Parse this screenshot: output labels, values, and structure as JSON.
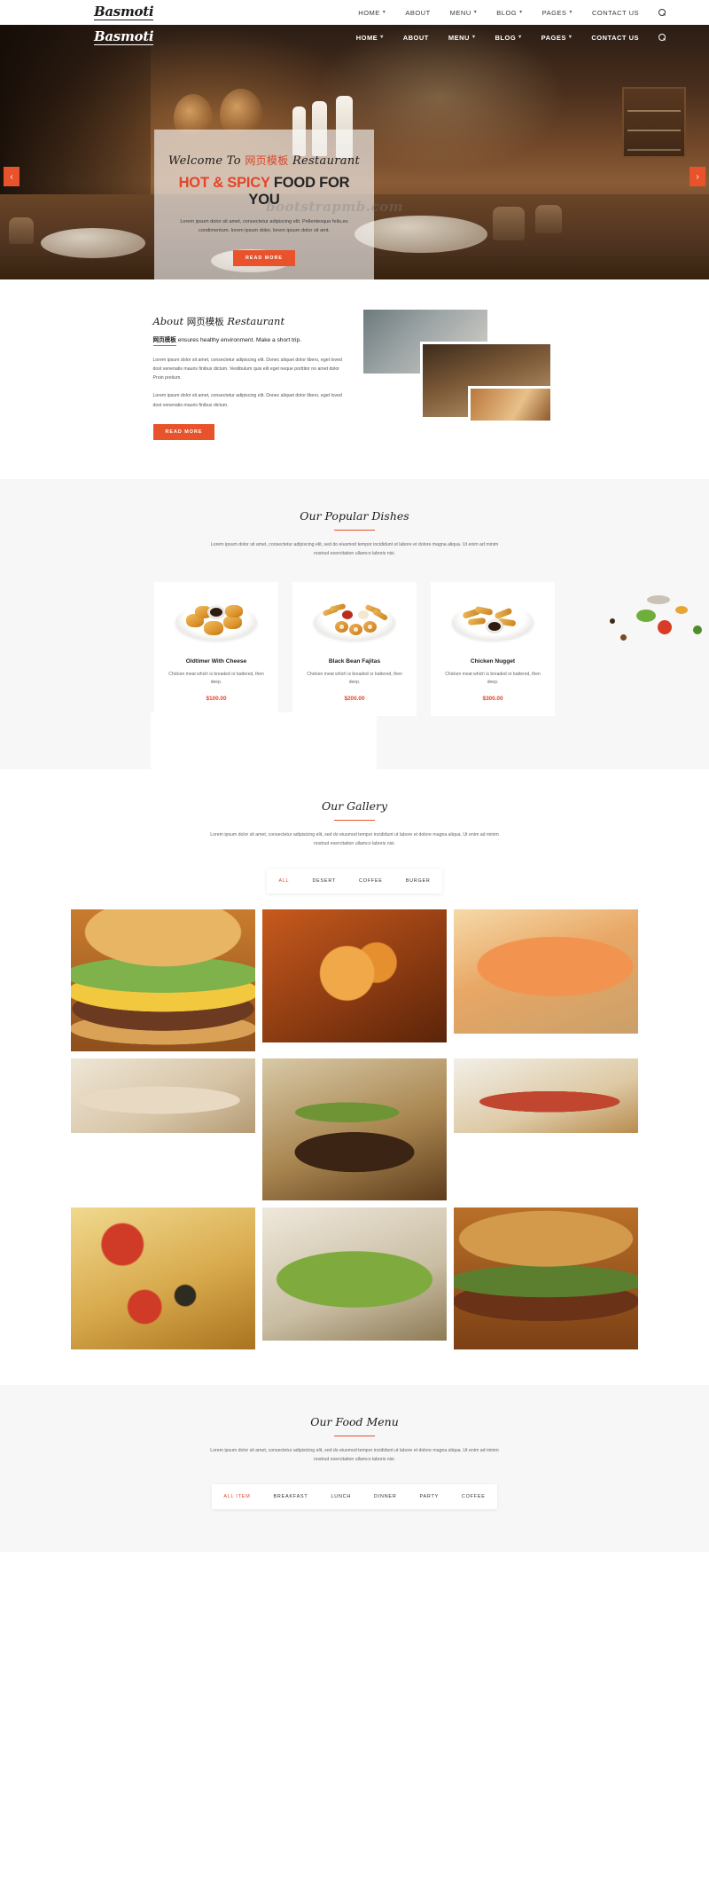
{
  "site": {
    "brand": "Basmoti",
    "watermark": "bootstrapmb.com"
  },
  "nav": {
    "items": [
      {
        "label": "HOME",
        "caret": true
      },
      {
        "label": "ABOUT",
        "caret": false
      },
      {
        "label": "MENU",
        "caret": true
      },
      {
        "label": "BLOG",
        "caret": true
      },
      {
        "label": "PAGES",
        "caret": true
      },
      {
        "label": "CONTACT US",
        "caret": false
      }
    ],
    "search_icon": "search-icon"
  },
  "hero": {
    "welcome_prefix": "Welcome To ",
    "welcome_cn": "网页模板",
    "welcome_suffix": " Restaurant",
    "title_accent": "HOT & SPICY",
    "title_rest": " FOOD FOR YOU",
    "paragraph": "Lorem ipsum dolor sit amet, consectetur adipiscing elit. Pellentesque felis,eu condimentum. lorem ipsum dolor, lorem ipsum dolor sit amt.",
    "button": "READ MORE",
    "prev_arrow": "‹",
    "next_arrow": "›"
  },
  "about": {
    "heading_prefix": "About ",
    "heading_cn": "网页模板",
    "heading_suffix": " Restaurant",
    "sub_strong": "网页模板",
    "sub_rest": " ensures healthy environment. Make a short trip.",
    "paragraph1": "Lorem ipsum dolor sit amet, consectetur adipiscing elit. Donec aliquet dolor libero, eget loved dost venenatis mauris finibus dictum. Vestibulum quis elit eget neque porttitor no amet dolor Proin pretium.",
    "paragraph2": "Lorem ipsum dolor sit amet, consectetur adipiscing elit. Donec aliquet dolor libero, eget loved dost venenatis mauris finibus dictum.",
    "button": "READ MORE"
  },
  "dishes": {
    "title": "Our Popular Dishes",
    "description": "Lorem ipsum dolor sit amet, consectetur adipiscing elit, sed do eiusmod tempor incididunt ut labore et dolore magna aliqua. Ut enim ad minim nostrud exercitation ullamco laboris nisi.",
    "items": [
      {
        "name": "Oldtimer With Cheese",
        "desc": "Chicken meat which is breaded or battered, then deep.",
        "price": "$100.00"
      },
      {
        "name": "Black Bean Fajitas",
        "desc": "Chicken meat which is breaded or battered, then deep.",
        "price": "$200.00"
      },
      {
        "name": "Chicken Nugget",
        "desc": "Chicken meat which is breaded or battered, then deep.",
        "price": "$300.00"
      }
    ]
  },
  "gallery": {
    "title": "Our Gallery",
    "description": "Lorem ipsum dolor sit amet, consectetur adipisicing elit, sed do eiusmod tempor incididunt ut labore et dolore magna aliqua. Ut enim ad minim nostrud exercitation ullamco laboris nisi.",
    "filters": [
      {
        "label": "ALL",
        "active": true
      },
      {
        "label": "DESERT",
        "active": false
      },
      {
        "label": "COFFEE",
        "active": false
      },
      {
        "label": "BURGER",
        "active": false
      }
    ]
  },
  "food_menu": {
    "title": "Our Food Menu",
    "description": "Lorem ipsum dolor sit amet, consectetur adipisicing elit, sed do eiusmod tempor incididunt ut labore et dolore magna aliqua. Ut enim ad minim nostrud exercitation ullamco laboris nisi.",
    "tabs": [
      {
        "label": "ALL ITEM",
        "active": true
      },
      {
        "label": "BREAKFAST",
        "active": false
      },
      {
        "label": "LUNCH",
        "active": false
      },
      {
        "label": "DINNER",
        "active": false
      },
      {
        "label": "PARTY",
        "active": false
      },
      {
        "label": "COFFEE",
        "active": false
      }
    ]
  },
  "colors": {
    "accent": "#e8532b",
    "accent_text": "#e2452a",
    "dark": "#1b1b1b",
    "bg_alt": "#f7f7f7"
  }
}
